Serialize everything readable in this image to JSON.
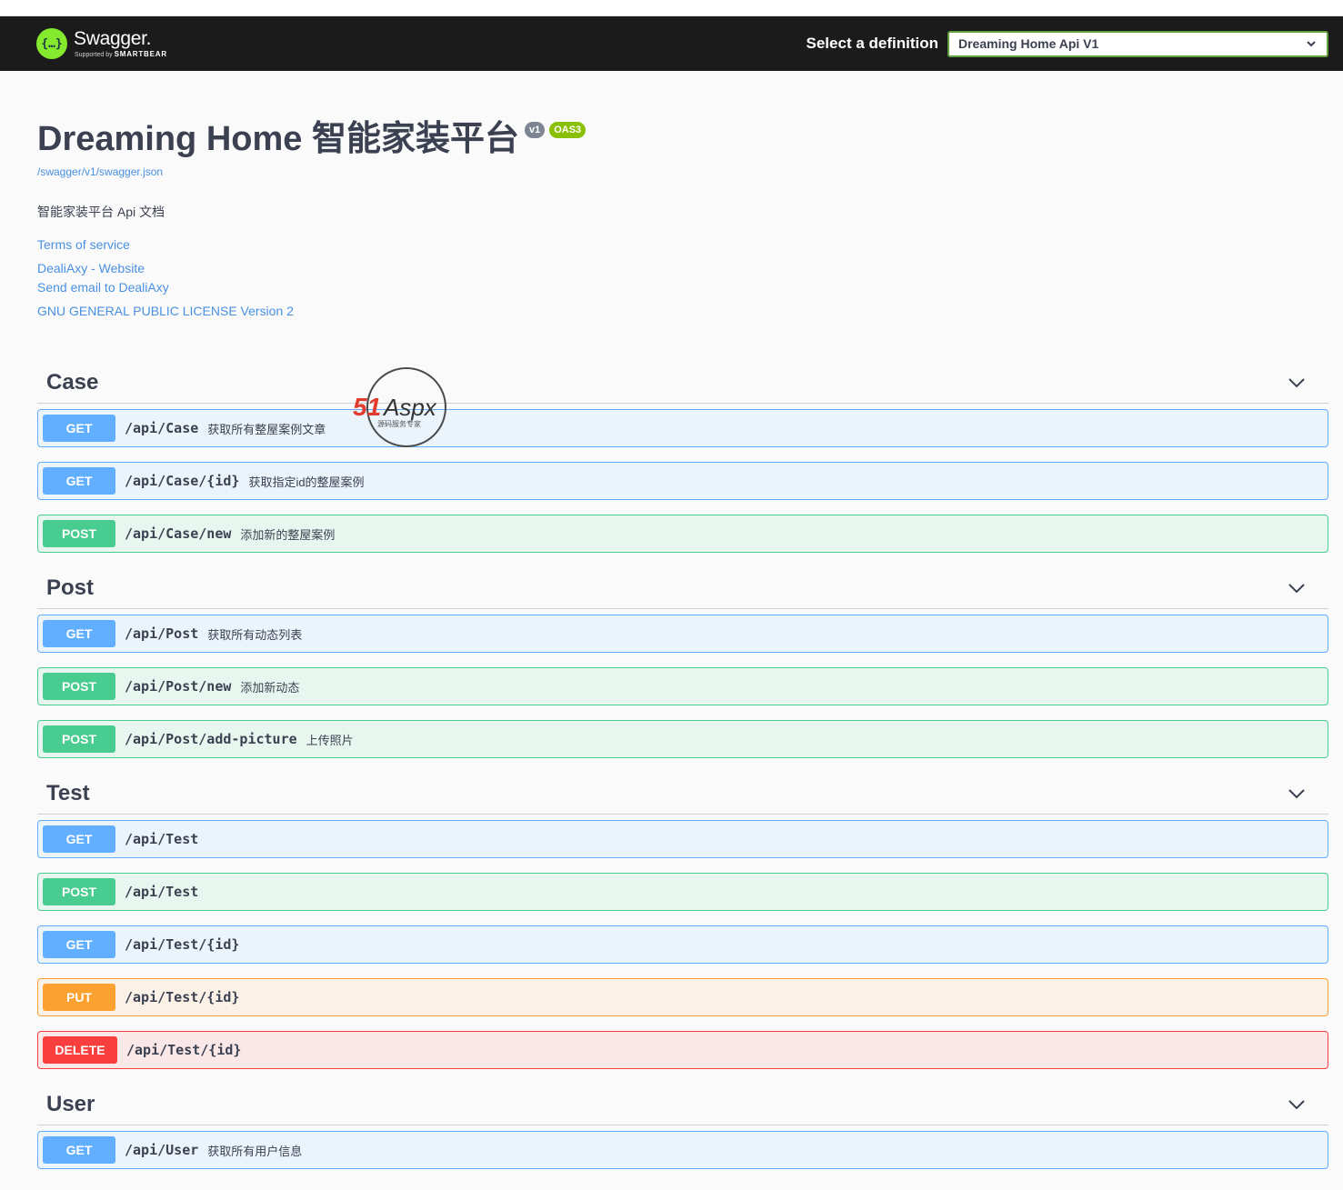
{
  "topbar": {
    "logo_title": "Swagger.",
    "logo_sub_prefix": "Supported by",
    "logo_sub_brand": "SMARTBEAR",
    "definition_label": "Select a definition",
    "definition_value": "Dreaming Home Api V1"
  },
  "info": {
    "title": "Dreaming Home 智能家装平台",
    "version_badge": "v1",
    "oas_badge": "OAS3",
    "spec_url": "/swagger/v1/swagger.json",
    "description": "智能家装平台 Api 文档",
    "terms": "Terms of service",
    "website": "DealiAxy - Website",
    "email": "Send email to DealiAxy",
    "license": "GNU GENERAL PUBLIC LICENSE Version 2"
  },
  "watermark": {
    "brand": "51Aspx",
    "sub": "源码服务专家"
  },
  "tags": [
    {
      "name": "Case",
      "ops": [
        {
          "method": "GET",
          "path": "/api/Case",
          "summary": "获取所有整屋案例文章"
        },
        {
          "method": "GET",
          "path": "/api/Case/{id}",
          "summary": "获取指定id的整屋案例"
        },
        {
          "method": "POST",
          "path": "/api/Case/new",
          "summary": "添加新的整屋案例"
        }
      ]
    },
    {
      "name": "Post",
      "ops": [
        {
          "method": "GET",
          "path": "/api/Post",
          "summary": "获取所有动态列表"
        },
        {
          "method": "POST",
          "path": "/api/Post/new",
          "summary": "添加新动态"
        },
        {
          "method": "POST",
          "path": "/api/Post/add-picture",
          "summary": "上传照片"
        }
      ]
    },
    {
      "name": "Test",
      "ops": [
        {
          "method": "GET",
          "path": "/api/Test",
          "summary": ""
        },
        {
          "method": "POST",
          "path": "/api/Test",
          "summary": ""
        },
        {
          "method": "GET",
          "path": "/api/Test/{id}",
          "summary": ""
        },
        {
          "method": "PUT",
          "path": "/api/Test/{id}",
          "summary": ""
        },
        {
          "method": "DELETE",
          "path": "/api/Test/{id}",
          "summary": ""
        }
      ]
    },
    {
      "name": "User",
      "ops": [
        {
          "method": "GET",
          "path": "/api/User",
          "summary": "获取所有用户信息"
        }
      ]
    }
  ]
}
